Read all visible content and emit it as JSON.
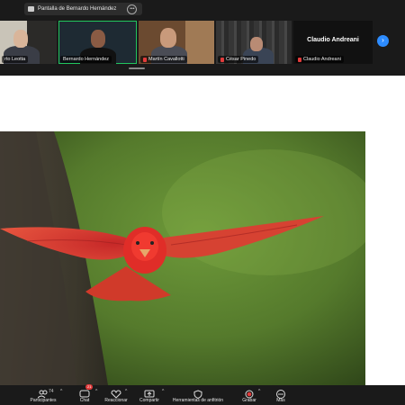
{
  "share_bar": {
    "title": "Pantalla de Bernardo Hernández"
  },
  "participants": [
    {
      "name": "rto Leotta",
      "muted": false
    },
    {
      "name": "Bernardo Hernández",
      "muted": false,
      "active": true
    },
    {
      "name": "Martín Cavallotti",
      "muted": true
    },
    {
      "name": "César Pinedo",
      "muted": true
    },
    {
      "name": "Claudio Andreani",
      "muted": true
    }
  ],
  "name_tile": {
    "name": "Claudio Andreani"
  },
  "toolbar": {
    "participants_label": "Participantes",
    "participants_count": "74",
    "chat_label": "Chat",
    "chat_badge": "21",
    "react_label": "Reaccionar",
    "share_label": "Compartir",
    "annotate_label": "Herramientas de anfitrión",
    "record_label": "Grabar",
    "more_label": "Más"
  },
  "colors": {
    "accent": "#2d8cff",
    "active_border": "#22c55e",
    "muted": "#e23b3b",
    "bar": "#1a1a1a"
  }
}
